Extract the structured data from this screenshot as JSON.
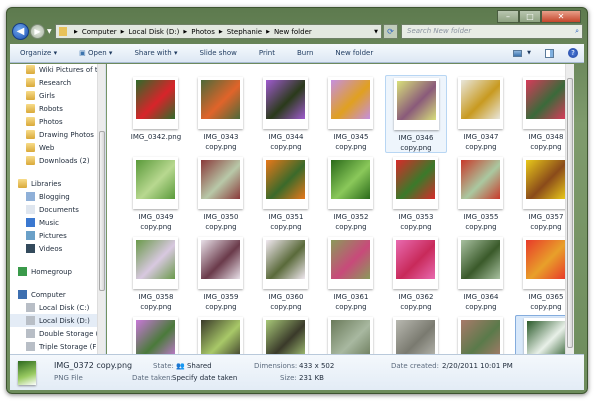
{
  "window": {
    "controls": [
      "minimize",
      "maximize",
      "close"
    ]
  },
  "address": {
    "crumbs": [
      "Computer",
      "Local Disk (D:)",
      "Photos",
      "Stephanie",
      "New folder"
    ]
  },
  "search": {
    "placeholder": "Search New folder"
  },
  "toolbar": {
    "organize": "Organize",
    "open": "Open",
    "share_with": "Share with",
    "slide_show": "Slide show",
    "print": "Print",
    "burn": "Burn",
    "new_folder": "New folder"
  },
  "navpane": {
    "items": [
      {
        "label": "Wiki Pictures of t",
        "icon": "folder-icon",
        "indent": 1
      },
      {
        "label": "Research",
        "icon": "folder-icon",
        "indent": 1
      },
      {
        "label": "Girls",
        "icon": "folder-icon",
        "indent": 1
      },
      {
        "label": "Robots",
        "icon": "folder-icon",
        "indent": 1
      },
      {
        "label": "Photos",
        "icon": "folder-icon",
        "indent": 1
      },
      {
        "label": "Drawing Photos",
        "icon": "folder-icon",
        "indent": 1
      },
      {
        "label": "Web",
        "icon": "folder-icon",
        "indent": 1
      },
      {
        "label": "Downloads (2)",
        "icon": "folder-icon",
        "indent": 1
      },
      {
        "label": "Libraries",
        "icon": "libraries-icon",
        "indent": 0,
        "gap": true
      },
      {
        "label": "Blogging",
        "icon": "library-icon",
        "indent": 1
      },
      {
        "label": "Documents",
        "icon": "documents-icon",
        "indent": 1
      },
      {
        "label": "Music",
        "icon": "music-icon",
        "indent": 1
      },
      {
        "label": "Pictures",
        "icon": "pictures-icon",
        "indent": 1
      },
      {
        "label": "Videos",
        "icon": "videos-icon",
        "indent": 1
      },
      {
        "label": "Homegroup",
        "icon": "homegroup-icon",
        "indent": 0,
        "gap": true
      },
      {
        "label": "Computer",
        "icon": "computer-icon",
        "indent": 0,
        "gap": true
      },
      {
        "label": "Local Disk (C:)",
        "icon": "drive-icon",
        "indent": 1
      },
      {
        "label": "Local Disk (D:)",
        "icon": "drive-icon",
        "indent": 1,
        "selected": true
      },
      {
        "label": "Double Storage (",
        "icon": "drive-icon",
        "indent": 1
      },
      {
        "label": "Triple Storage (F",
        "icon": "drive-icon",
        "indent": 1
      }
    ]
  },
  "files": [
    {
      "name": "IMG_0342.png",
      "line2": "",
      "colors": [
        "#2f6b2a",
        "#d8242a"
      ]
    },
    {
      "name": "IMG_0343",
      "line2": "copy.png",
      "colors": [
        "#4d6a3a",
        "#e0642a"
      ]
    },
    {
      "name": "IMG_0344",
      "line2": "copy.png",
      "colors": [
        "#a05bd0",
        "#2a3a1a"
      ]
    },
    {
      "name": "IMG_0345",
      "line2": "copy.png",
      "colors": [
        "#c58fe0",
        "#e0a020"
      ]
    },
    {
      "name": "IMG_0346",
      "line2": "copy.png",
      "colors": [
        "#d8e07a",
        "#8a5a7a"
      ],
      "state": "hover"
    },
    {
      "name": "IMG_0347",
      "line2": "copy.png",
      "colors": [
        "#e8e6dc",
        "#c89a20"
      ]
    },
    {
      "name": "IMG_0348",
      "line2": "copy.png",
      "colors": [
        "#d83a5a",
        "#3a6a3a"
      ]
    },
    {
      "name": "IMG_0349",
      "line2": "copy.png",
      "colors": [
        "#5a9a3a",
        "#b8d890"
      ]
    },
    {
      "name": "IMG_0350",
      "line2": "copy.png",
      "colors": [
        "#8a3a3a",
        "#b8c8a8"
      ]
    },
    {
      "name": "IMG_0351",
      "line2": "copy.png",
      "colors": [
        "#e8781a",
        "#3a6a2a"
      ]
    },
    {
      "name": "IMG_0352",
      "line2": "copy.png",
      "colors": [
        "#2a6a1a",
        "#8ac85a"
      ]
    },
    {
      "name": "IMG_0353",
      "line2": "copy.png",
      "colors": [
        "#d82a2a",
        "#3a7a2a"
      ]
    },
    {
      "name": "IMG_0355",
      "line2": "copy.png",
      "colors": [
        "#c83a2a",
        "#aac8a0"
      ]
    },
    {
      "name": "IMG_0357",
      "line2": "copy.png",
      "colors": [
        "#e8c81a",
        "#8a4a1a"
      ]
    },
    {
      "name": "IMG_0358",
      "line2": "copy.png",
      "colors": [
        "#6a9a4a",
        "#d8c8e0"
      ]
    },
    {
      "name": "IMG_0359",
      "line2": "copy.png",
      "colors": [
        "#e8e0e8",
        "#6a3a4a"
      ]
    },
    {
      "name": "IMG_0360",
      "line2": "copy.png",
      "colors": [
        "#f0e8f0",
        "#5a6a3a"
      ]
    },
    {
      "name": "IMG_0361",
      "line2": "copy.png",
      "colors": [
        "#8a9a5a",
        "#c84a7a"
      ]
    },
    {
      "name": "IMG_0362",
      "line2": "copy.png",
      "colors": [
        "#e86ab0",
        "#c82a5a"
      ]
    },
    {
      "name": "IMG_0364",
      "line2": "copy.png",
      "colors": [
        "#a8c0a0",
        "#3a5a2a"
      ]
    },
    {
      "name": "IMG_0365",
      "line2": "copy.png",
      "colors": [
        "#e83a2a",
        "#e8a02a"
      ]
    },
    {
      "name": "",
      "line2": "",
      "colors": [
        "#c878d8",
        "#4a7a3a"
      ]
    },
    {
      "name": "",
      "line2": "",
      "colors": [
        "#3a3a2a",
        "#a8c868"
      ]
    },
    {
      "name": "",
      "line2": "",
      "colors": [
        "#a8c878",
        "#3a3a2a"
      ]
    },
    {
      "name": "",
      "line2": "",
      "colors": [
        "#6a7a5a",
        "#a8b8a0"
      ]
    },
    {
      "name": "",
      "line2": "",
      "colors": [
        "#b8b8b0",
        "#7a7a70"
      ]
    },
    {
      "name": "",
      "line2": "",
      "colors": [
        "#a87a6a",
        "#5a7a4a"
      ]
    },
    {
      "name": "",
      "line2": "",
      "colors": [
        "#2a5a2a",
        "#e8f0e8"
      ],
      "state": "selected"
    }
  ],
  "details": {
    "filename": "IMG_0372 copy.png",
    "filetype": "PNG File",
    "state_label": "State:",
    "state_value": "Shared",
    "date_taken_label": "Date taken:",
    "date_taken_value": "Specify date taken",
    "dimensions_label": "Dimensions:",
    "dimensions_value": "433 x 502",
    "size_label": "Size:",
    "size_value": "231 KB",
    "date_created_label": "Date created:",
    "date_created_value": "2/20/2011 10:01 PM"
  }
}
